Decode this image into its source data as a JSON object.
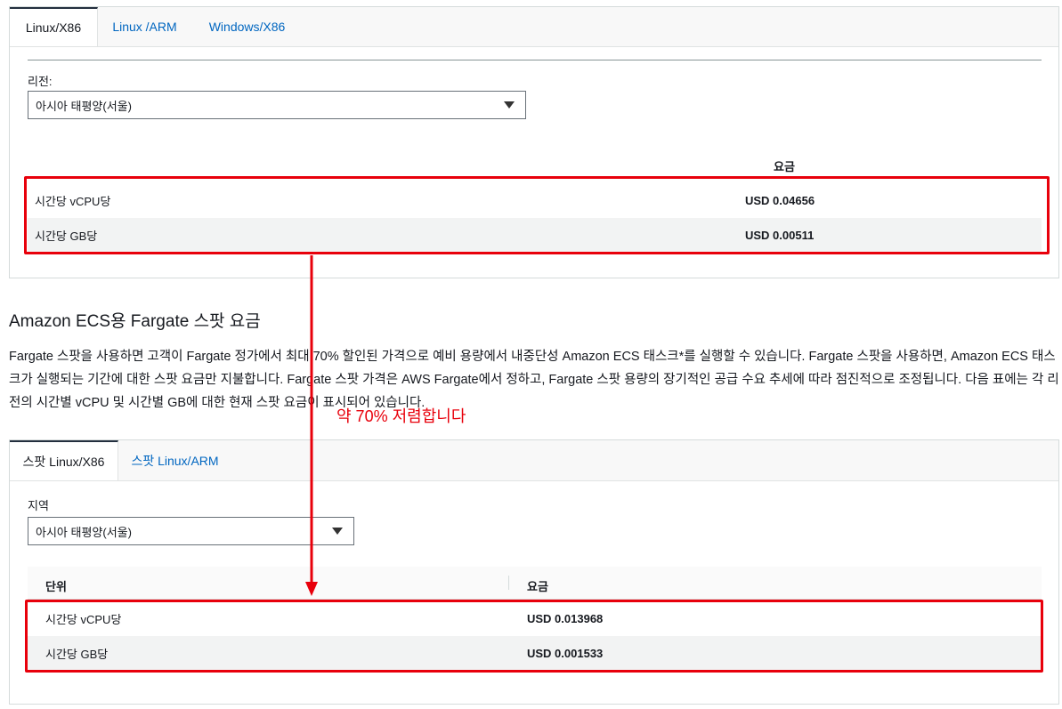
{
  "top_panel": {
    "tabs": [
      {
        "label": "Linux/X86",
        "active": true
      },
      {
        "label": "Linux /ARM",
        "active": false
      },
      {
        "label": "Windows/X86",
        "active": false
      }
    ],
    "region_label": "리전:",
    "region_value": "아시아 태평양(서울)",
    "price_header": "요금",
    "rows": [
      {
        "unit": "시간당 vCPU당",
        "price": "USD 0.04656"
      },
      {
        "unit": "시간당 GB당",
        "price": "USD 0.00511"
      }
    ]
  },
  "section": {
    "title": "Amazon ECS용 Fargate 스팟 요금",
    "paragraph": "Fargate 스팟을 사용하면 고객이 Fargate 정가에서 최대 70% 할인된 가격으로 예비 용량에서 내중단성 Amazon ECS 태스크*를 실행할 수 있습니다. Fargate 스팟을 사용하면, Amazon ECS 태스크가 실행되는 기간에 대한 스팟 요금만 지불합니다. Fargate 스팟 가격은 AWS Fargate에서 정하고, Fargate 스팟 용량의 장기적인 공급 수요 추세에 따라 점진적으로 조정됩니다. 다음 표에는 각 리전의 시간별 vCPU 및 시간별 GB에 대한 현재 스팟 요금이 표시되어 있습니다."
  },
  "annotation": {
    "note": "약 70% 저렴합니다",
    "highlight_color": "#e8000b"
  },
  "bottom_panel": {
    "tabs": [
      {
        "label": "스팟 Linux/X86",
        "active": true
      },
      {
        "label": "스팟 Linux/ARM",
        "active": false
      }
    ],
    "region_label": "지역",
    "region_value": "아시아 태평양(서울)",
    "col_unit": "단위",
    "col_price": "요금",
    "rows": [
      {
        "unit": "시간당 vCPU당",
        "price": "USD 0.013968"
      },
      {
        "unit": "시간당 GB당",
        "price": "USD 0.001533"
      }
    ]
  },
  "colors": {
    "link": "#0066c0",
    "text": "#16191f",
    "border": "#d5dbdb",
    "stripe": "#f2f3f3"
  }
}
